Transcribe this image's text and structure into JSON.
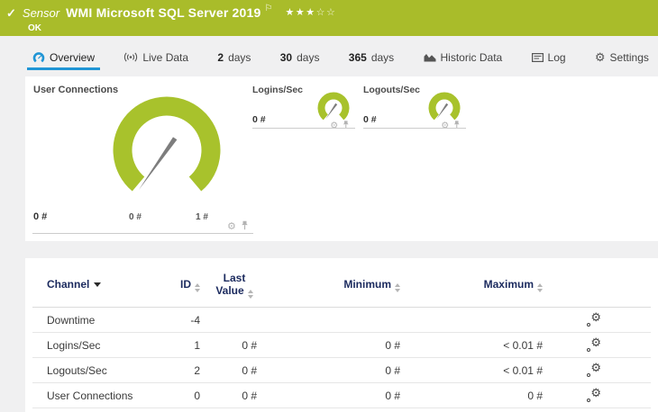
{
  "header": {
    "check_glyph": "✓",
    "kind_label": "Sensor",
    "title": "WMI Microsoft SQL Server 2019",
    "flag_glyph": "⚐",
    "status": "OK",
    "rating": [
      "★",
      "★",
      "★",
      "☆",
      "☆"
    ]
  },
  "tabs": [
    {
      "label": "Overview",
      "icon": "gauge-icon",
      "active": true
    },
    {
      "label": "Live Data",
      "icon": "broadcast-icon"
    },
    {
      "bold": "2",
      "label": "days"
    },
    {
      "bold": "30",
      "label": "days"
    },
    {
      "bold": "365",
      "label": "days"
    },
    {
      "label": "Historic Data",
      "icon": "area-chart-icon"
    },
    {
      "label": "Log",
      "icon": "log-icon"
    },
    {
      "label": "Settings",
      "icon": "gear-icon"
    }
  ],
  "gauges": {
    "primary": {
      "title": "User Connections",
      "value": "0 #",
      "scale_min": "0 #",
      "scale_max": "1 #"
    },
    "logins": {
      "title": "Logins/Sec",
      "value": "0 #"
    },
    "logouts": {
      "title": "Logouts/Sec",
      "value": "0 #"
    }
  },
  "channel_table": {
    "headers": {
      "channel": "Channel",
      "id": "ID",
      "last_line1": "Last",
      "last_line2": "Value",
      "min": "Minimum",
      "max": "Maximum"
    },
    "rows": [
      {
        "channel": "Downtime",
        "id": "-4",
        "last": "",
        "min": "",
        "max": ""
      },
      {
        "channel": "Logins/Sec",
        "id": "1",
        "last": "0 #",
        "min": "0 #",
        "max": "< 0.01 #"
      },
      {
        "channel": "Logouts/Sec",
        "id": "2",
        "last": "0 #",
        "min": "0 #",
        "max": "< 0.01 #"
      },
      {
        "channel": "User Connections",
        "id": "0",
        "last": "0 #",
        "min": "0 #",
        "max": "0 #"
      }
    ]
  },
  "colors": {
    "status_green": "#a9bc2a",
    "gauge_green": "#a8c22c",
    "accent_blue": "#2095d5",
    "header_navy": "#1b2a5e"
  }
}
